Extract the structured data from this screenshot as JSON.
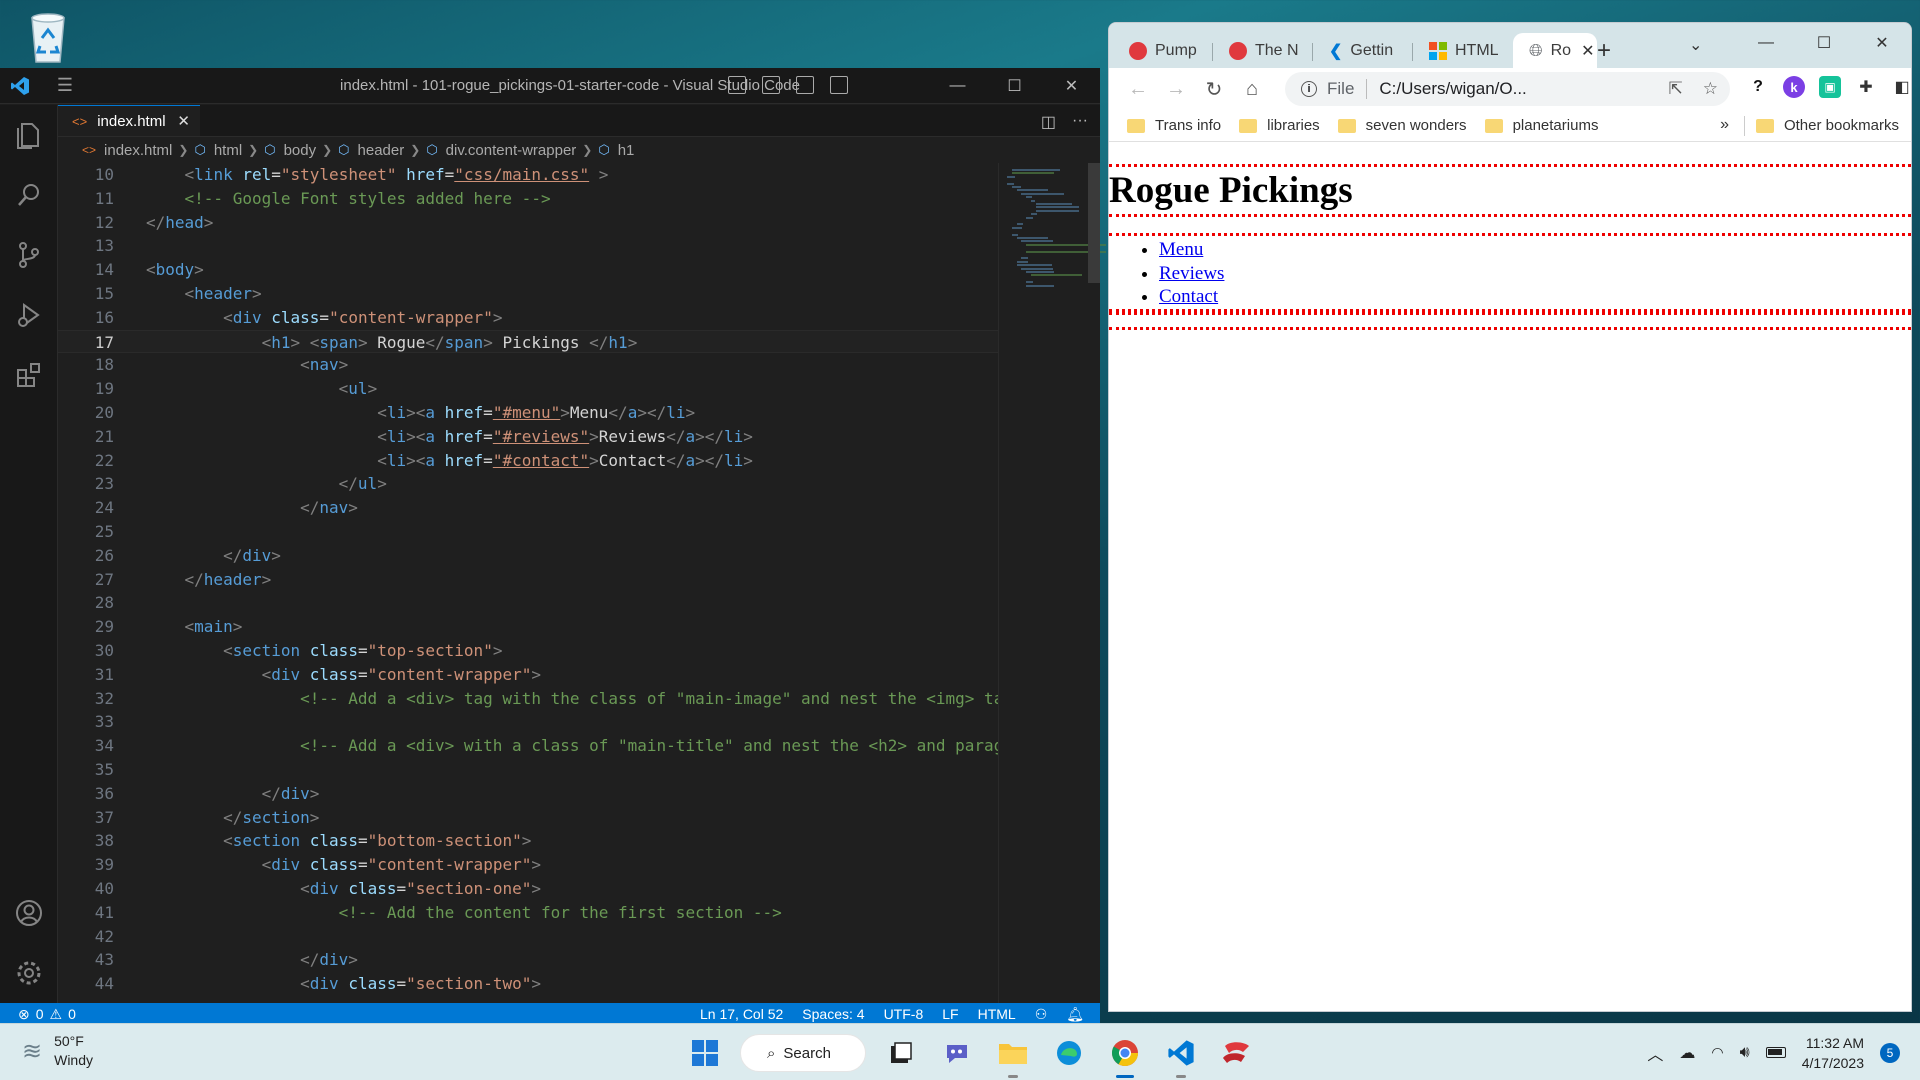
{
  "desktop": {
    "recycle_bin_icon": "recycle-bin-icon"
  },
  "vscode": {
    "title": "index.html - 101-rogue_pickings-01-starter-code - Visual Studio Code",
    "tab": {
      "label": "index.html"
    },
    "breadcrumb": [
      "index.html",
      "html",
      "body",
      "header",
      "div.content-wrapper",
      "h1"
    ],
    "status": {
      "errors": "0",
      "warnings": "0",
      "position": "Ln 17, Col 52",
      "spaces": "Spaces: 4",
      "encoding": "UTF-8",
      "eol": "LF",
      "language": "HTML"
    },
    "colors": {
      "accent": "#0078d4",
      "tag": "#569cd6",
      "attr": "#9cdcfe",
      "string": "#ce9178",
      "comment": "#6a9955"
    },
    "current_line": 17,
    "lines": [
      {
        "n": "10",
        "indent": 4,
        "tokens": [
          [
            "br",
            "<"
          ],
          [
            "tag",
            "link"
          ],
          [
            "txt",
            " "
          ],
          [
            "attr",
            "rel"
          ],
          [
            "txt",
            "="
          ],
          [
            "str",
            "\"stylesheet\""
          ],
          [
            "txt",
            " "
          ],
          [
            "attr",
            "href"
          ],
          [
            "txt",
            "="
          ],
          [
            "str",
            "\"css/main.css\""
          ],
          [
            "txt",
            " "
          ],
          [
            "br",
            ">"
          ]
        ]
      },
      {
        "n": "11",
        "indent": 4,
        "tokens": [
          [
            "cm",
            "<!-- Google Font styles added here -->"
          ]
        ]
      },
      {
        "n": "12",
        "indent": 0,
        "tokens": [
          [
            "br",
            "</"
          ],
          [
            "tag",
            "head"
          ],
          [
            "br",
            ">"
          ]
        ]
      },
      {
        "n": "13",
        "indent": 0,
        "tokens": []
      },
      {
        "n": "14",
        "indent": 0,
        "tokens": [
          [
            "br",
            "<"
          ],
          [
            "tag",
            "body"
          ],
          [
            "br",
            ">"
          ]
        ]
      },
      {
        "n": "15",
        "indent": 4,
        "tokens": [
          [
            "br",
            "<"
          ],
          [
            "tag",
            "header"
          ],
          [
            "br",
            ">"
          ]
        ]
      },
      {
        "n": "16",
        "indent": 8,
        "tokens": [
          [
            "br",
            "<"
          ],
          [
            "tag",
            "div"
          ],
          [
            "txt",
            " "
          ],
          [
            "attr",
            "class"
          ],
          [
            "txt",
            "="
          ],
          [
            "str",
            "\"content-wrapper\""
          ],
          [
            "br",
            ">"
          ]
        ]
      },
      {
        "n": "17",
        "indent": 12,
        "tokens": [
          [
            "br",
            "<"
          ],
          [
            "tag",
            "h1"
          ],
          [
            "br",
            ">"
          ],
          [
            "txt",
            " "
          ],
          [
            "br",
            "<"
          ],
          [
            "tag",
            "span"
          ],
          [
            "br",
            ">"
          ],
          [
            "txt",
            " Rogue"
          ],
          [
            "br",
            "</"
          ],
          [
            "tag",
            "span"
          ],
          [
            "br",
            ">"
          ],
          [
            "txt",
            " Pickings "
          ],
          [
            "br",
            "</"
          ],
          [
            "tag",
            "h1"
          ],
          [
            "br",
            ">"
          ]
        ]
      },
      {
        "n": "18",
        "indent": 16,
        "tokens": [
          [
            "br",
            "<"
          ],
          [
            "tag",
            "nav"
          ],
          [
            "br",
            ">"
          ]
        ]
      },
      {
        "n": "19",
        "indent": 20,
        "tokens": [
          [
            "br",
            "<"
          ],
          [
            "tag",
            "ul"
          ],
          [
            "br",
            ">"
          ]
        ]
      },
      {
        "n": "20",
        "indent": 24,
        "tokens": [
          [
            "br",
            "<"
          ],
          [
            "tag",
            "li"
          ],
          [
            "br",
            "><"
          ],
          [
            "tag",
            "a"
          ],
          [
            "txt",
            " "
          ],
          [
            "attr",
            "href"
          ],
          [
            "txt",
            "="
          ],
          [
            "str",
            "\"#menu\""
          ],
          [
            "br",
            ">"
          ],
          [
            "txt",
            "Menu"
          ],
          [
            "br",
            "</"
          ],
          [
            "tag",
            "a"
          ],
          [
            "br",
            "></"
          ],
          [
            "tag",
            "li"
          ],
          [
            "br",
            ">"
          ]
        ]
      },
      {
        "n": "21",
        "indent": 24,
        "tokens": [
          [
            "br",
            "<"
          ],
          [
            "tag",
            "li"
          ],
          [
            "br",
            "><"
          ],
          [
            "tag",
            "a"
          ],
          [
            "txt",
            " "
          ],
          [
            "attr",
            "href"
          ],
          [
            "txt",
            "="
          ],
          [
            "str",
            "\"#reviews\""
          ],
          [
            "br",
            ">"
          ],
          [
            "txt",
            "Reviews"
          ],
          [
            "br",
            "</"
          ],
          [
            "tag",
            "a"
          ],
          [
            "br",
            "></"
          ],
          [
            "tag",
            "li"
          ],
          [
            "br",
            ">"
          ]
        ]
      },
      {
        "n": "22",
        "indent": 24,
        "tokens": [
          [
            "br",
            "<"
          ],
          [
            "tag",
            "li"
          ],
          [
            "br",
            "><"
          ],
          [
            "tag",
            "a"
          ],
          [
            "txt",
            " "
          ],
          [
            "attr",
            "href"
          ],
          [
            "txt",
            "="
          ],
          [
            "str",
            "\"#contact\""
          ],
          [
            "br",
            ">"
          ],
          [
            "txt",
            "Contact"
          ],
          [
            "br",
            "</"
          ],
          [
            "tag",
            "a"
          ],
          [
            "br",
            "></"
          ],
          [
            "tag",
            "li"
          ],
          [
            "br",
            ">"
          ]
        ]
      },
      {
        "n": "23",
        "indent": 20,
        "tokens": [
          [
            "br",
            "</"
          ],
          [
            "tag",
            "ul"
          ],
          [
            "br",
            ">"
          ]
        ]
      },
      {
        "n": "24",
        "indent": 16,
        "tokens": [
          [
            "br",
            "</"
          ],
          [
            "tag",
            "nav"
          ],
          [
            "br",
            ">"
          ]
        ]
      },
      {
        "n": "25",
        "indent": 0,
        "tokens": []
      },
      {
        "n": "26",
        "indent": 8,
        "tokens": [
          [
            "br",
            "</"
          ],
          [
            "tag",
            "div"
          ],
          [
            "br",
            ">"
          ]
        ]
      },
      {
        "n": "27",
        "indent": 4,
        "tokens": [
          [
            "br",
            "</"
          ],
          [
            "tag",
            "header"
          ],
          [
            "br",
            ">"
          ]
        ]
      },
      {
        "n": "28",
        "indent": 0,
        "tokens": []
      },
      {
        "n": "29",
        "indent": 4,
        "tokens": [
          [
            "br",
            "<"
          ],
          [
            "tag",
            "main"
          ],
          [
            "br",
            ">"
          ]
        ]
      },
      {
        "n": "30",
        "indent": 8,
        "tokens": [
          [
            "br",
            "<"
          ],
          [
            "tag",
            "section"
          ],
          [
            "txt",
            " "
          ],
          [
            "attr",
            "class"
          ],
          [
            "txt",
            "="
          ],
          [
            "str",
            "\"top-section\""
          ],
          [
            "br",
            ">"
          ]
        ]
      },
      {
        "n": "31",
        "indent": 12,
        "tokens": [
          [
            "br",
            "<"
          ],
          [
            "tag",
            "div"
          ],
          [
            "txt",
            " "
          ],
          [
            "attr",
            "class"
          ],
          [
            "txt",
            "="
          ],
          [
            "str",
            "\"content-wrapper\""
          ],
          [
            "br",
            ">"
          ]
        ]
      },
      {
        "n": "32",
        "indent": 16,
        "tokens": [
          [
            "cm",
            "<!-- Add a <div> tag with the class of \"main-image\" and nest the <img> ta"
          ]
        ]
      },
      {
        "n": "33",
        "indent": 0,
        "tokens": []
      },
      {
        "n": "34",
        "indent": 16,
        "tokens": [
          [
            "cm",
            "<!-- Add a <div> with a class of \"main-title\" and nest the <h2> and parag"
          ]
        ]
      },
      {
        "n": "35",
        "indent": 0,
        "tokens": []
      },
      {
        "n": "36",
        "indent": 12,
        "tokens": [
          [
            "br",
            "</"
          ],
          [
            "tag",
            "div"
          ],
          [
            "br",
            ">"
          ]
        ]
      },
      {
        "n": "37",
        "indent": 8,
        "tokens": [
          [
            "br",
            "</"
          ],
          [
            "tag",
            "section"
          ],
          [
            "br",
            ">"
          ]
        ]
      },
      {
        "n": "38",
        "indent": 8,
        "tokens": [
          [
            "br",
            "<"
          ],
          [
            "tag",
            "section"
          ],
          [
            "txt",
            " "
          ],
          [
            "attr",
            "class"
          ],
          [
            "txt",
            "="
          ],
          [
            "str",
            "\"bottom-section\""
          ],
          [
            "br",
            ">"
          ]
        ]
      },
      {
        "n": "39",
        "indent": 12,
        "tokens": [
          [
            "br",
            "<"
          ],
          [
            "tag",
            "div"
          ],
          [
            "txt",
            " "
          ],
          [
            "attr",
            "class"
          ],
          [
            "txt",
            "="
          ],
          [
            "str",
            "\"content-wrapper\""
          ],
          [
            "br",
            ">"
          ]
        ]
      },
      {
        "n": "40",
        "indent": 16,
        "tokens": [
          [
            "br",
            "<"
          ],
          [
            "tag",
            "div"
          ],
          [
            "txt",
            " "
          ],
          [
            "attr",
            "class"
          ],
          [
            "txt",
            "="
          ],
          [
            "str",
            "\"section-one\""
          ],
          [
            "br",
            ">"
          ]
        ]
      },
      {
        "n": "41",
        "indent": 20,
        "tokens": [
          [
            "cm",
            "<!-- Add the content for the first section -->"
          ]
        ]
      },
      {
        "n": "42",
        "indent": 0,
        "tokens": []
      },
      {
        "n": "43",
        "indent": 16,
        "tokens": [
          [
            "br",
            "</"
          ],
          [
            "tag",
            "div"
          ],
          [
            "br",
            ">"
          ]
        ]
      },
      {
        "n": "44",
        "indent": 16,
        "tokens": [
          [
            "br",
            "<"
          ],
          [
            "tag",
            "div"
          ],
          [
            "txt",
            " "
          ],
          [
            "attr",
            "class"
          ],
          [
            "txt",
            "="
          ],
          [
            "str",
            "\"section-two\""
          ],
          [
            "br",
            ">"
          ]
        ]
      }
    ]
  },
  "chrome": {
    "tabs": [
      {
        "label": "Pump",
        "favicon_color": "#e0393e"
      },
      {
        "label": "The N",
        "favicon_color": "#e0393e"
      },
      {
        "label": "Gettin",
        "favicon_color": "#0078d4"
      },
      {
        "label": "HTML",
        "favicon_color": "#f25022"
      },
      {
        "label": "Ro",
        "favicon_color": "#5f6368"
      }
    ],
    "omnibox": {
      "scheme": "File",
      "url": "C:/Users/wigan/O..."
    },
    "bookmarks": [
      "Trans info",
      "libraries",
      "seven wonders",
      "planetariums"
    ],
    "bookmarks_more": "»",
    "other_bookmarks": "Other bookmarks",
    "page": {
      "h1": "Rogue Pickings",
      "nav": [
        "Menu",
        "Reviews",
        "Contact"
      ]
    }
  },
  "taskbar": {
    "weather_temp": "50°F",
    "weather_desc": "Windy",
    "search_label": "Search",
    "time": "11:32 AM",
    "date": "4/17/2023",
    "notifications": "5"
  }
}
